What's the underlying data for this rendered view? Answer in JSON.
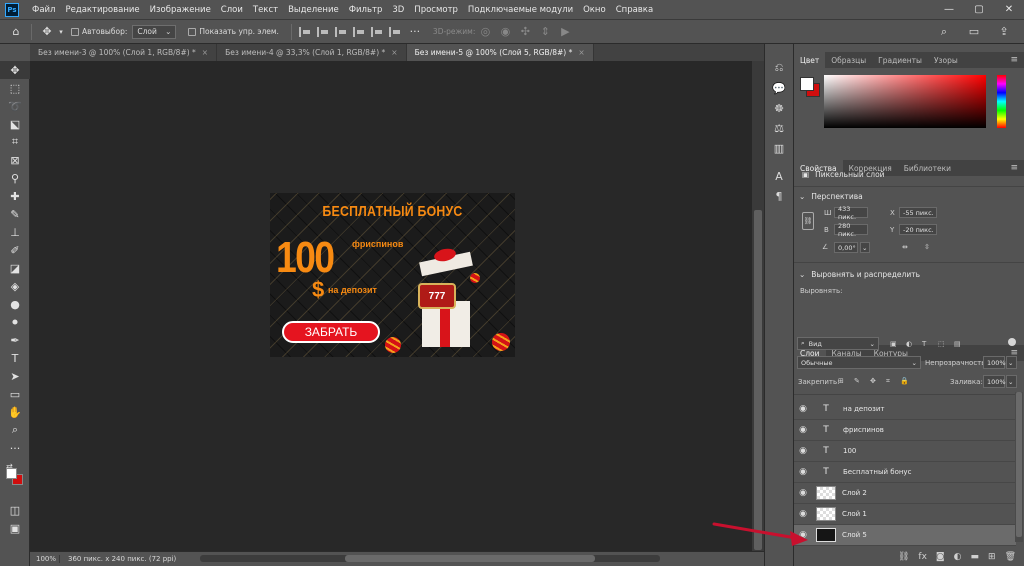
{
  "menubar": {
    "logo": "Ps",
    "items": [
      "Файл",
      "Редактирование",
      "Изображение",
      "Слои",
      "Текст",
      "Выделение",
      "Фильтр",
      "3D",
      "Просмотр",
      "Подключаемые модули",
      "Окно",
      "Справка"
    ],
    "window_controls": [
      "—",
      "▢",
      "✕"
    ]
  },
  "options": {
    "autoselect_label": "Автовыбор:",
    "autoselect_value": "Слой",
    "show_controls_label": "Показать упр. элем.",
    "mode3d_label": "3D-режим:"
  },
  "tabs": [
    {
      "label": "Без имени-3 @ 100% (Слой 1, RGB/8#) *",
      "close": "×"
    },
    {
      "label": "Без имени-4 @ 33,3% (Слой 1, RGB/8#) *",
      "close": "×"
    },
    {
      "label": "Без имени-5 @ 100% (Слой 5, RGB/8#) *",
      "close": "×"
    }
  ],
  "banner": {
    "title": "БЕСПЛАТНЫЙ БОНУС",
    "amount": "100",
    "freespins": "фриспинов",
    "dollar": "$",
    "deposit": "на депозит",
    "button": "ЗАБРАТЬ",
    "slot": "777"
  },
  "status": {
    "zoom": "100%",
    "doc_info": "360 пикс. x 240 пикс. (72 ppi)"
  },
  "color_panel": {
    "tabs": [
      "Цвет",
      "Образцы",
      "Градиенты",
      "Узоры"
    ],
    "fg_color": "#ffffff",
    "bg_color": "#d00d0d"
  },
  "properties_panel": {
    "tabs": [
      "Свойства",
      "Коррекция",
      "Библиотеки"
    ],
    "layer_type": "Пиксельный слой",
    "transform_title": "Перспектива",
    "w_label": "Ш",
    "w_value": "433 пикс.",
    "h_label": "В",
    "h_value": "280 пикс.",
    "x_label": "X",
    "x_value": "-55 пикс.",
    "y_label": "Y",
    "y_value": "-20 пикс.",
    "angle_value": "0,00°",
    "align_title": "Выровнять и распределить",
    "align_label": "Выровнять:"
  },
  "layers_panel": {
    "tabs": [
      "Слои",
      "Каналы",
      "Контуры"
    ],
    "filter_value": "Вид",
    "blend_mode": "Обычные",
    "opacity_label": "Непрозрачность:",
    "opacity_value": "100%",
    "lock_label": "Закрепить:",
    "fill_label": "Заливка:",
    "fill_value": "100%",
    "layers": [
      {
        "name": "на депозит",
        "kind": "text"
      },
      {
        "name": "фриспинов",
        "kind": "text"
      },
      {
        "name": "100",
        "kind": "text"
      },
      {
        "name": "Бесплатный бонус",
        "kind": "text"
      },
      {
        "name": "Слой 2",
        "kind": "pixel"
      },
      {
        "name": "Слой 1",
        "kind": "pixel"
      },
      {
        "name": "Слой 5",
        "kind": "pixel-dark",
        "selected": true
      }
    ]
  },
  "colors": {
    "app_bg": "#535353",
    "canvas_bg": "#282828",
    "accent_orange": "#f78a12",
    "button_red": "#e5141f",
    "annotation_arrow": "#c8102e"
  }
}
